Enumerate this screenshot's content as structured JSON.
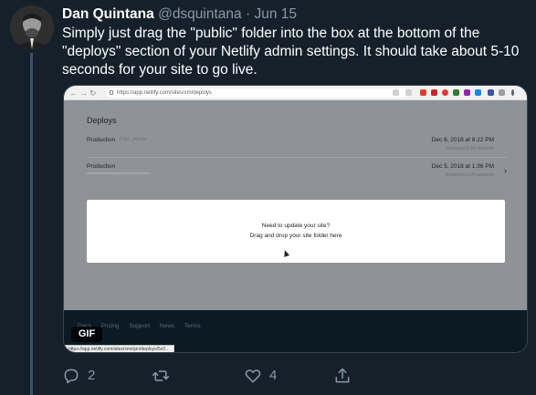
{
  "tweet": {
    "author_name": "Dan Quintana",
    "handle": "@dsquintana",
    "separator": "·",
    "date": "Jun 15",
    "text": "Simply just drag the \"public\" folder into the box at the bottom of the \"deploys\" section of your Netlify admin settings. It should take about 5-10 seconds for your site to go live."
  },
  "media": {
    "browser": {
      "url": "https://app.netlify.com/sites/xm/deploys"
    },
    "page": {
      "title": "Deploys",
      "deploys": [
        {
          "label": "Production",
          "hash": "Publ…ments",
          "date": "Dec 6, 2018 at 8:22 PM",
          "status": "Deployed in 10 seconds"
        },
        {
          "label": "Production",
          "hash": "",
          "date": "Dec 5, 2018 at 1:36 PM",
          "status": "Deployed in 20 seconds"
        }
      ],
      "dropzone": {
        "line1": "Need to update your site?",
        "line2": "Drag and drop your site folder here"
      },
      "footer_links": [
        "Docs",
        "Pricing",
        "Support",
        "News",
        "Terms"
      ]
    },
    "gif_label": "GIF",
    "status_url": "https://app.netlify.com/sites/xmslyin/deploys/5c0…"
  },
  "actions": {
    "reply_count": "2",
    "retweet_count": "",
    "like_count": "4"
  },
  "colors": {
    "background": "#15202b",
    "secondary_text": "#8899a6",
    "border": "#38444d"
  }
}
